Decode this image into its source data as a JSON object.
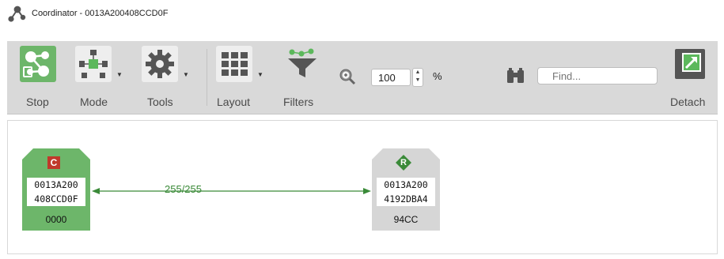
{
  "window": {
    "title": "Coordinator - 0013A200408CCD0F"
  },
  "toolbar": {
    "buttons": [
      {
        "label": "Stop",
        "icon": "network-stop-icon",
        "active": true
      },
      {
        "label": "Mode",
        "icon": "mode-icon"
      },
      {
        "label": "Tools",
        "icon": "gear-icon"
      },
      {
        "label": "Layout",
        "icon": "grid-icon"
      },
      {
        "label": "Filters",
        "icon": "funnel-icon"
      },
      {
        "label": "Detach",
        "icon": "detach-icon"
      }
    ],
    "zoom": {
      "value": "100",
      "unit": "%"
    },
    "find": {
      "placeholder": "Find..."
    }
  },
  "graph": {
    "nodes": [
      {
        "badge": "C",
        "addr_line1": "0013A200",
        "addr_line2": "408CCD0F",
        "id": "0000",
        "role": "coordinator",
        "color": "#6db66a"
      },
      {
        "badge": "R",
        "addr_line1": "0013A200",
        "addr_line2": "4192DBA4",
        "id": "94CC",
        "role": "router",
        "color": "#d6d6d6"
      }
    ],
    "link": {
      "label": "255/255",
      "color": "#3a8a38"
    }
  },
  "colors": {
    "accent_green": "#6db66a",
    "coordinator_badge": "#c0392b",
    "router_badge": "#3a8a38"
  }
}
